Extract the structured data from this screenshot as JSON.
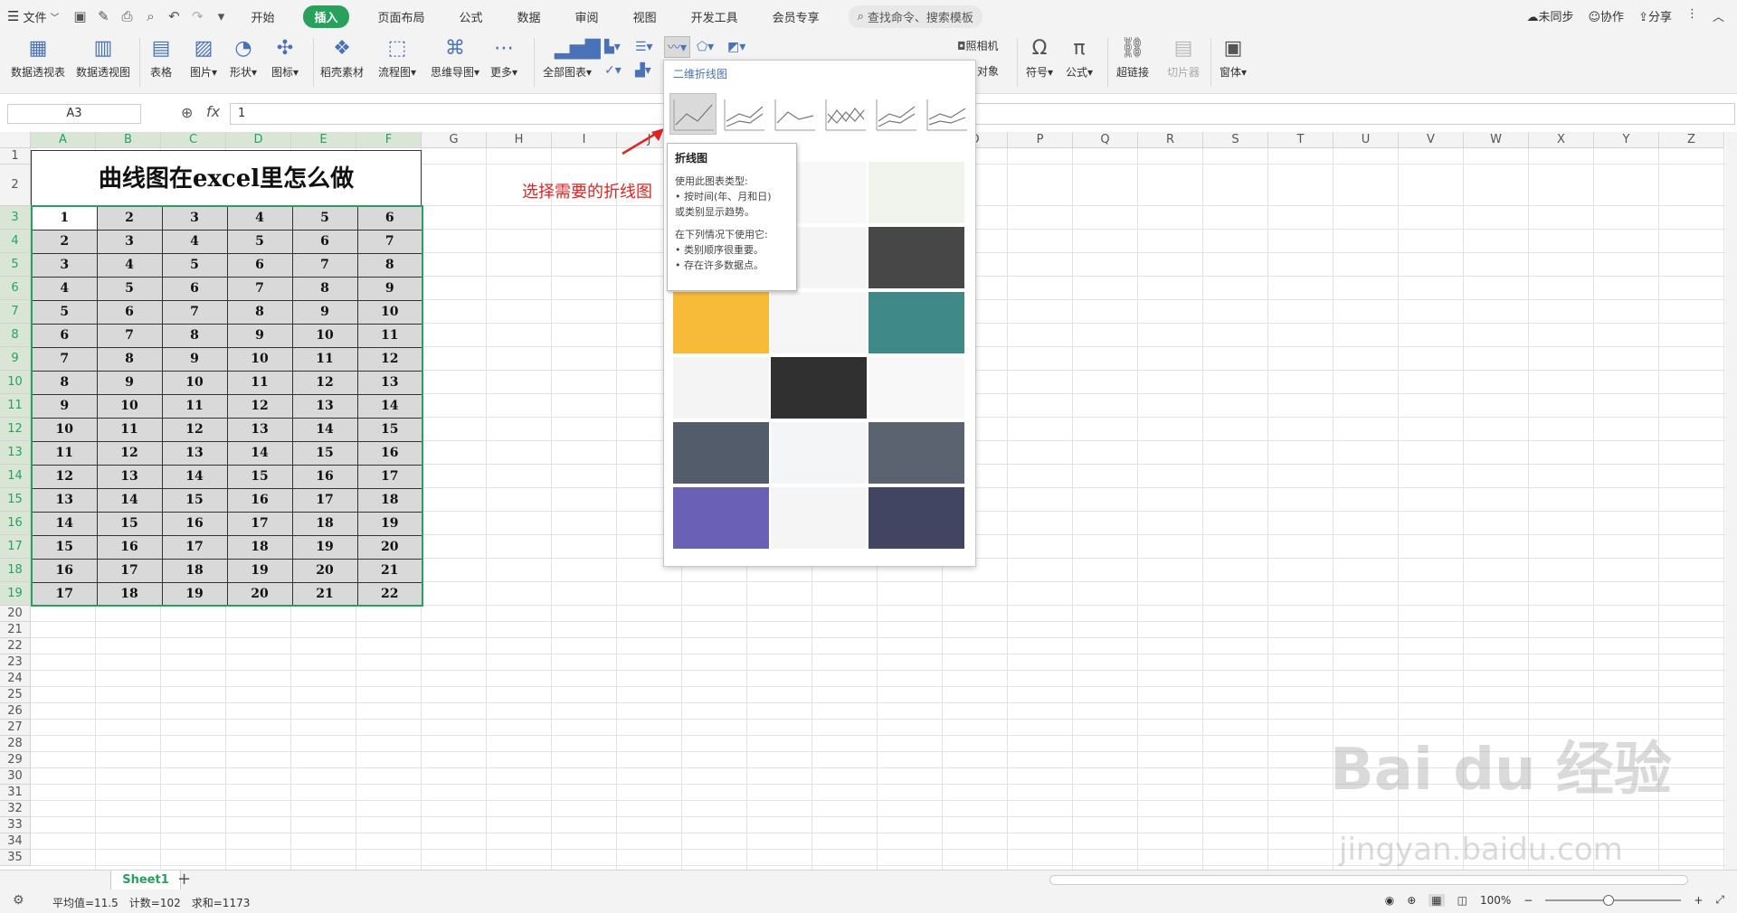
{
  "menubar": {
    "file_label": "文件",
    "tabs": [
      "开始",
      "插入",
      "页面布局",
      "公式",
      "数据",
      "审阅",
      "视图",
      "开发工具",
      "会员专享"
    ],
    "active_tab": "插入",
    "search_placeholder": "查找命令、搜索模板",
    "right": [
      "未同步",
      "协作",
      "分享"
    ]
  },
  "ribbon": {
    "buttons": [
      "数据透视表",
      "数据透视图",
      "表格",
      "图片",
      "形状",
      "图标",
      "稻壳素材",
      "流程图",
      "思维导图",
      "更多",
      "全部图表",
      "照相机",
      "对象",
      "符号",
      "公式",
      "超链接",
      "切片器",
      "窗体"
    ]
  },
  "formula_bar": {
    "namebox": "A3",
    "fx": "fx",
    "value": "1"
  },
  "columns": [
    "A",
    "B",
    "C",
    "D",
    "E",
    "F",
    "G",
    "H",
    "I",
    "J",
    "K",
    "L",
    "M",
    "N",
    "O",
    "P",
    "Q",
    "R",
    "S",
    "T",
    "U",
    "V",
    "W",
    "X",
    "Y",
    "Z"
  ],
  "rows": [
    "1",
    "2",
    "3",
    "4",
    "5",
    "6",
    "7",
    "8",
    "9",
    "10",
    "11",
    "12",
    "13",
    "14",
    "15",
    "16",
    "17",
    "18",
    "19",
    "20",
    "21",
    "22",
    "23",
    "24",
    "25",
    "26",
    "27",
    "28",
    "29",
    "30",
    "31",
    "32",
    "33",
    "34",
    "35"
  ],
  "sheet": {
    "title": "曲线图在excel里怎么做",
    "table": [
      [
        "1",
        "2",
        "3",
        "4",
        "5",
        "6"
      ],
      [
        "2",
        "3",
        "4",
        "5",
        "6",
        "7"
      ],
      [
        "3",
        "4",
        "5",
        "6",
        "7",
        "8"
      ],
      [
        "4",
        "5",
        "6",
        "7",
        "8",
        "9"
      ],
      [
        "5",
        "6",
        "7",
        "8",
        "9",
        "10"
      ],
      [
        "6",
        "7",
        "8",
        "9",
        "10",
        "11"
      ],
      [
        "7",
        "8",
        "9",
        "10",
        "11",
        "12"
      ],
      [
        "8",
        "9",
        "10",
        "11",
        "12",
        "13"
      ],
      [
        "9",
        "10",
        "11",
        "12",
        "13",
        "14"
      ],
      [
        "10",
        "11",
        "12",
        "13",
        "14",
        "15"
      ],
      [
        "11",
        "12",
        "13",
        "14",
        "15",
        "16"
      ],
      [
        "12",
        "13",
        "14",
        "15",
        "16",
        "17"
      ],
      [
        "13",
        "14",
        "15",
        "16",
        "17",
        "18"
      ],
      [
        "14",
        "15",
        "16",
        "17",
        "18",
        "19"
      ],
      [
        "15",
        "16",
        "17",
        "18",
        "19",
        "20"
      ],
      [
        "16",
        "17",
        "18",
        "19",
        "20",
        "21"
      ],
      [
        "17",
        "18",
        "19",
        "20",
        "21",
        "22"
      ]
    ]
  },
  "annotation": "选择需要的折线图",
  "dropdown": {
    "title": "二维折线图",
    "tooltip": {
      "heading": "折线图",
      "lines": [
        "使用此图表类型:",
        "• 按时间(年、月和日)",
        "或类别显示趋势。",
        "",
        "在下列情况下使用它:",
        "• 类别顺序很重要。",
        "• 存在许多数据点。"
      ]
    },
    "thumb_colors": [
      "#f4f4f4",
      "#f7f7f7",
      "#eef3ea",
      "#e9ecef",
      "#f3f3f3",
      "#333333",
      "#f6b324",
      "#f5f5f5",
      "#2b7c7c",
      "#f3f3f3",
      "#1a1a1a",
      "#f7f7f7",
      "#3f4a5a",
      "#f2f4f5",
      "#4a5260",
      "#5a4fae",
      "#f4f4f4",
      "#2c3150"
    ]
  },
  "sheetbar": {
    "tab": "Sheet1",
    "add": "+"
  },
  "status": {
    "avg": "平均值=11.5",
    "count": "计数=102",
    "sum": "求和=1173",
    "zoom": "100%"
  },
  "watermark": {
    "main": "Bai du 经验",
    "sub": "jingyan.baidu.com"
  }
}
